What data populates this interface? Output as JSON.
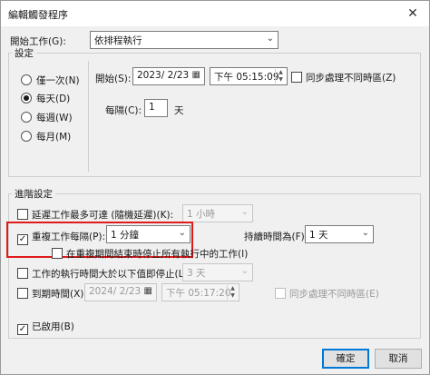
{
  "window": {
    "title": "編輯觸發程序",
    "close_glyph": "✕"
  },
  "start_task": {
    "label": "開始工作(G):",
    "value": "依排程執行"
  },
  "settings": {
    "label": "設定",
    "radios": [
      {
        "label": "僅一次(N)",
        "selected": false
      },
      {
        "label": "每天(D)",
        "selected": true
      },
      {
        "label": "每週(W)",
        "selected": false
      },
      {
        "label": "每月(M)",
        "selected": false
      }
    ],
    "start_label": "開始(S):",
    "start_date": "2023/  2/23",
    "start_time": "下午 05:15:09",
    "sync_label": "同步處理不同時區(Z)",
    "recur_label": "每隔(C):",
    "recur_value": "1",
    "recur_unit": "天"
  },
  "advanced": {
    "label": "進階設定",
    "delay_label": "延遲工作最多可達 (隨機延遲)(K):",
    "delay_value": "1 小時",
    "repeat_label": "重複工作每隔(P):",
    "repeat_value": "1 分鐘",
    "duration_label": "持續時間為(F):",
    "duration_value": "1 天",
    "stop_running_label": "在重複期間結束時停止所有執行中的工作(I)",
    "stop_longer_label": "工作的執行時間大於以下值即停止(L):",
    "stop_longer_value": "3 天",
    "expire_label": "到期時間(X):",
    "expire_date": "2024/  2/23",
    "expire_time": "下午 05:17:20",
    "expire_sync_label": "同步處理不同時區(E)",
    "enabled_label": "已啟用(B)"
  },
  "buttons": {
    "ok": "確定",
    "cancel": "取消"
  },
  "colors": {
    "highlight": "#e01b1b",
    "accent": "#0078d7"
  }
}
